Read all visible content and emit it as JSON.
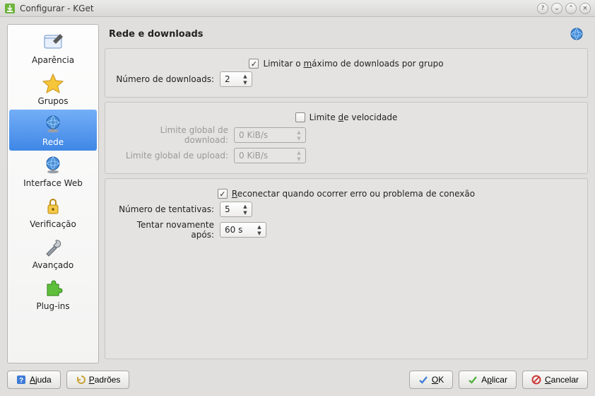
{
  "window": {
    "title": "Configurar - KGet"
  },
  "sidebar": {
    "items": [
      {
        "label": "Aparência"
      },
      {
        "label": "Grupos"
      },
      {
        "label": "Rede"
      },
      {
        "label": "Interface Web"
      },
      {
        "label": "Verificação"
      },
      {
        "label": "Avançado"
      },
      {
        "label": "Plug-ins"
      }
    ],
    "selected_index": 2
  },
  "page": {
    "title": "Rede e downloads",
    "group_downloads": {
      "limit_per_group_checked": true,
      "limit_per_group_pre": "Limitar o ",
      "limit_per_group_ul": "m",
      "limit_per_group_post": "áximo de downloads por grupo",
      "num_downloads_label": "Número de downloads:",
      "num_downloads_value": "2"
    },
    "group_speed": {
      "speed_limit_checked": false,
      "speed_limit_pre": "Limite ",
      "speed_limit_ul": "d",
      "speed_limit_post": "e velocidade",
      "global_dl_label": "Limite global de download:",
      "global_dl_value": "0 KiB/s",
      "global_ul_label": "Limite global de upload:",
      "global_ul_value": "0 KiB/s"
    },
    "group_reconnect": {
      "reconnect_checked": true,
      "reconnect_ul": "R",
      "reconnect_post": "econectar quando ocorrer erro ou problema de conexão",
      "retries_label": "Número de tentativas:",
      "retries_value": "5",
      "retry_after_label": "Tentar novamente após:",
      "retry_after_value": "60 s"
    }
  },
  "buttons": {
    "help_ul": "A",
    "help_post": "juda",
    "defaults_ul": "P",
    "defaults_post": "adrões",
    "ok_ul": "O",
    "ok_post": "K",
    "apply_pre": "A",
    "apply_ul": "p",
    "apply_post": "licar",
    "cancel_ul": "C",
    "cancel_post": "ancelar"
  }
}
